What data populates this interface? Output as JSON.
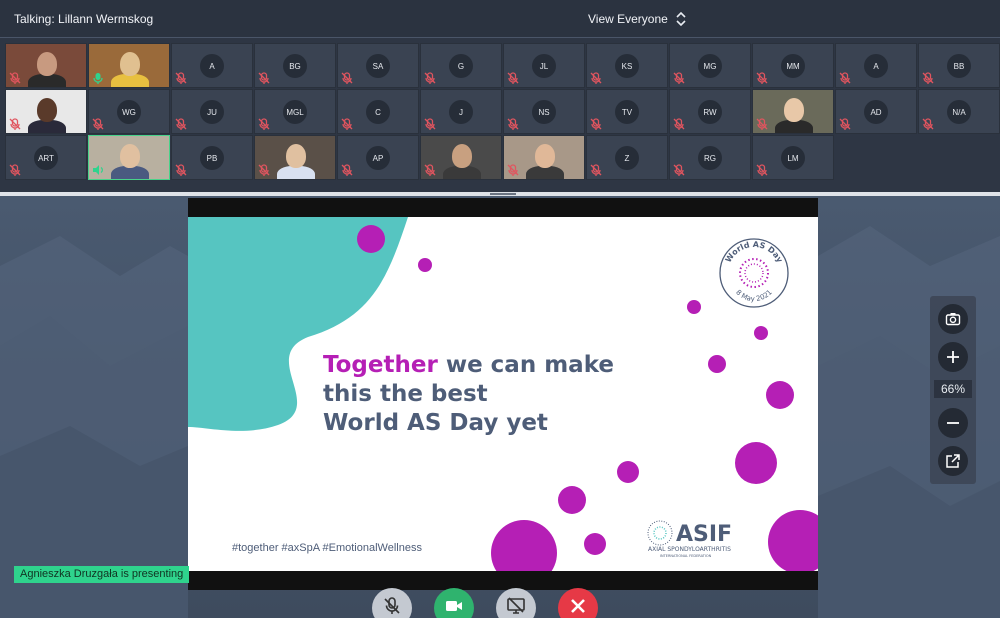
{
  "header": {
    "talking": "Talking: Lillann Wermskog",
    "view_mode": "View Everyone"
  },
  "participants": [
    {
      "initials": "",
      "video": true,
      "muted": true
    },
    {
      "initials": "",
      "video": true,
      "muted": false
    },
    {
      "initials": "A",
      "video": false,
      "muted": true
    },
    {
      "initials": "BG",
      "video": false,
      "muted": true
    },
    {
      "initials": "SA",
      "video": false,
      "muted": true
    },
    {
      "initials": "G",
      "video": false,
      "muted": true
    },
    {
      "initials": "JL",
      "video": false,
      "muted": true
    },
    {
      "initials": "KS",
      "video": false,
      "muted": true
    },
    {
      "initials": "MG",
      "video": false,
      "muted": true
    },
    {
      "initials": "MM",
      "video": false,
      "muted": true
    },
    {
      "initials": "A",
      "video": false,
      "muted": true
    },
    {
      "initials": "BB",
      "video": false,
      "muted": true
    },
    {
      "initials": "",
      "video": true,
      "muted": true
    },
    {
      "initials": "WG",
      "video": false,
      "muted": true
    },
    {
      "initials": "JU",
      "video": false,
      "muted": true
    },
    {
      "initials": "MGL",
      "video": false,
      "muted": true
    },
    {
      "initials": "C",
      "video": false,
      "muted": true
    },
    {
      "initials": "J",
      "video": false,
      "muted": true
    },
    {
      "initials": "NS",
      "video": false,
      "muted": true
    },
    {
      "initials": "TV",
      "video": false,
      "muted": true
    },
    {
      "initials": "RW",
      "video": false,
      "muted": true
    },
    {
      "initials": "",
      "video": true,
      "muted": true
    },
    {
      "initials": "AD",
      "video": false,
      "muted": true
    },
    {
      "initials": "N/A",
      "video": false,
      "muted": true
    },
    {
      "initials": "ART",
      "video": false,
      "muted": true
    },
    {
      "initials": "",
      "video": true,
      "muted": false,
      "speaking": true
    },
    {
      "initials": "PB",
      "video": false,
      "muted": true
    },
    {
      "initials": "",
      "video": true,
      "muted": true
    },
    {
      "initials": "AP",
      "video": false,
      "muted": true
    },
    {
      "initials": "",
      "video": true,
      "muted": true
    },
    {
      "initials": "",
      "video": true,
      "muted": true
    },
    {
      "initials": "Z",
      "video": false,
      "muted": true
    },
    {
      "initials": "RG",
      "video": false,
      "muted": true
    },
    {
      "initials": "LM",
      "video": false,
      "muted": true
    }
  ],
  "slide": {
    "headline_highlight": "Together",
    "headline_rest_1": " we can make",
    "headline_line_2": "this the best",
    "headline_line_3": "World AS Day yet",
    "hashtags": "#together #axSpA #EmotionalWellness",
    "badge_title": "World AS Day",
    "badge_date": "8 May 2021",
    "logo_text": "ASIF",
    "logo_sub": "AXIAL SPONDYLOARTHRITIS",
    "logo_sub2": "INTERNATIONAL FEDERATION",
    "colors": {
      "teal": "#56c5c1",
      "magenta": "#b51fb5",
      "navy": "#4e5d78"
    }
  },
  "zoom": {
    "level": "66%",
    "icons": [
      "camera-icon",
      "plus-icon",
      "minus-icon",
      "popout-icon"
    ]
  },
  "presenter_banner": "Agnieszka Druzgała is presenting",
  "controls": {
    "icons": [
      "mic-off-icon",
      "video-camera-icon",
      "stop-share-icon",
      "hang-up-icon"
    ],
    "colors": {
      "mic": "#c4c9d1",
      "camera": "#2fb36e",
      "share": "#c4c9d1",
      "hangup": "#e63946"
    }
  },
  "theme": {
    "accent_green": "#2fd38d",
    "muted_red": "#e0555f"
  }
}
